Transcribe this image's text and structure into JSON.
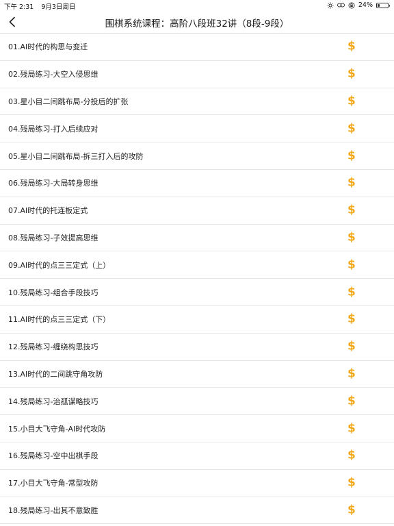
{
  "status_bar": {
    "time": "下午 2:31",
    "date": "9月3日周日",
    "battery_percent": "24%",
    "battery_level": 0.24
  },
  "header": {
    "title": "围棋系统课程：高阶八段班32讲（8段-9段）"
  },
  "colors": {
    "accent": "#f2a818",
    "divider": "#e6e6e6"
  },
  "price_icon_glyph": "$",
  "lessons": [
    {
      "title": "01.AI时代的构思与变迁"
    },
    {
      "title": "02.残局练习-大空入侵思维"
    },
    {
      "title": "03.星小目二间跳布局-分投后的扩张"
    },
    {
      "title": "04.残局练习-打入后续应对"
    },
    {
      "title": "05.星小目二间跳布局-拆三打入后的攻防"
    },
    {
      "title": "06.残局练习-大局转身思维"
    },
    {
      "title": "07.AI时代的托连板定式"
    },
    {
      "title": "08.残局练习-子效提高思维"
    },
    {
      "title": "09.AI时代的点三三定式（上）"
    },
    {
      "title": "10.残局练习-组合手段技巧"
    },
    {
      "title": "11.AI时代的点三三定式（下）"
    },
    {
      "title": "12.残局练习-缠绕构思技巧"
    },
    {
      "title": "13.AI时代的二间跳守角攻防"
    },
    {
      "title": "14.残局练习-治孤谋略技巧"
    },
    {
      "title": "15.小目大飞守角-AI时代攻防"
    },
    {
      "title": "16.残局练习-空中出棋手段"
    },
    {
      "title": "17.小目大飞守角-常型攻防"
    },
    {
      "title": "18.残局练习-出其不意致胜"
    }
  ]
}
